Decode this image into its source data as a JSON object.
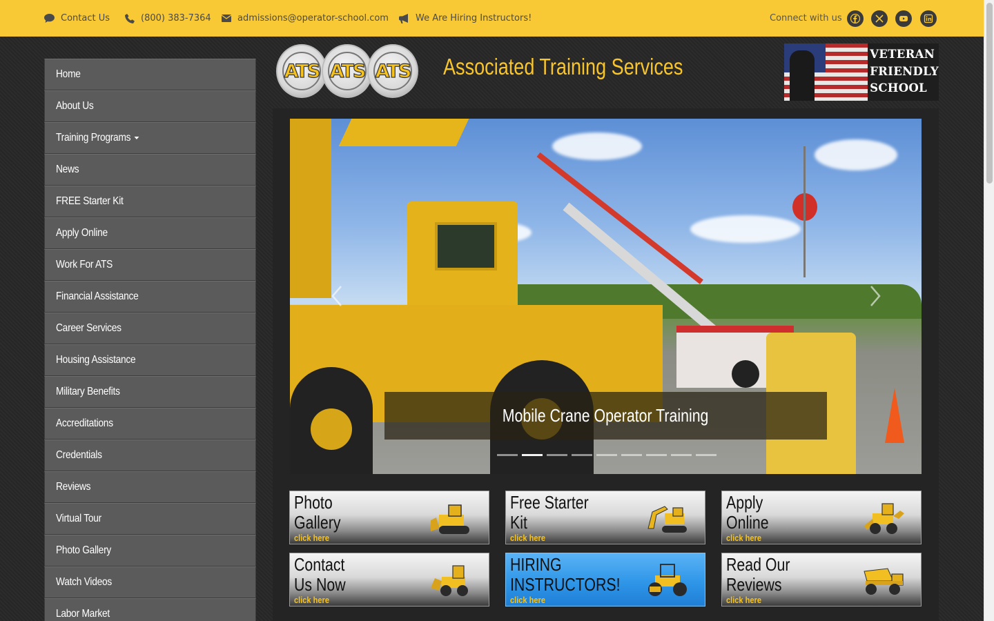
{
  "topbar": {
    "contact": "Contact Us",
    "phone": "(800) 383-7364",
    "email": "admissions@operator-school.com",
    "hiring": "We Are Hiring Instructors!",
    "connect": "Connect with us",
    "social": [
      "facebook-icon",
      "x-twitter-icon",
      "youtube-icon",
      "linkedin-icon"
    ]
  },
  "header": {
    "logo_text": "ATS",
    "title": "Associated Training Services",
    "badge": [
      "VETERAN",
      "FRIENDLY",
      "SCHOOL"
    ]
  },
  "sidebar": {
    "items": [
      {
        "label": "Home"
      },
      {
        "label": "About Us"
      },
      {
        "label": "Training Programs"
      },
      {
        "label": "News"
      },
      {
        "label": "FREE Starter Kit"
      },
      {
        "label": "Apply Online"
      },
      {
        "label": "Work For ATS"
      },
      {
        "label": "Financial Assistance"
      },
      {
        "label": "Career Services"
      },
      {
        "label": "Housing Assistance"
      },
      {
        "label": "Military Benefits"
      },
      {
        "label": "Accreditations"
      },
      {
        "label": "Credentials"
      },
      {
        "label": "Reviews"
      },
      {
        "label": "Virtual Tour"
      },
      {
        "label": "Photo Gallery"
      },
      {
        "label": "Watch Videos"
      },
      {
        "label": "Labor Market"
      }
    ]
  },
  "slider": {
    "caption": "Mobile Crane Operator Training",
    "slide_count": 9,
    "active_index": 1
  },
  "tiles": [
    {
      "title": "Photo\nGallery",
      "sub": "click here",
      "icon": "bulldozer-icon"
    },
    {
      "title": "Free Starter\nKit",
      "sub": "click here",
      "icon": "excavator-icon"
    },
    {
      "title": "Apply\nOnline",
      "sub": "click here",
      "icon": "backhoe-icon"
    },
    {
      "title": "Contact\nUs Now",
      "sub": "click here",
      "icon": "wheel-loader-icon"
    },
    {
      "title": "HIRING\nINSTRUCTORS!",
      "sub": "click here",
      "icon": "roller-icon"
    },
    {
      "title": "Read Our\nReviews",
      "sub": "click here",
      "icon": "dump-truck-icon"
    }
  ],
  "colors": {
    "topbar": "#f8c935",
    "accent_yellow": "#f8c52d",
    "nav_bg": "#5b5b5b",
    "hiring_blue": "#2f96e8"
  }
}
